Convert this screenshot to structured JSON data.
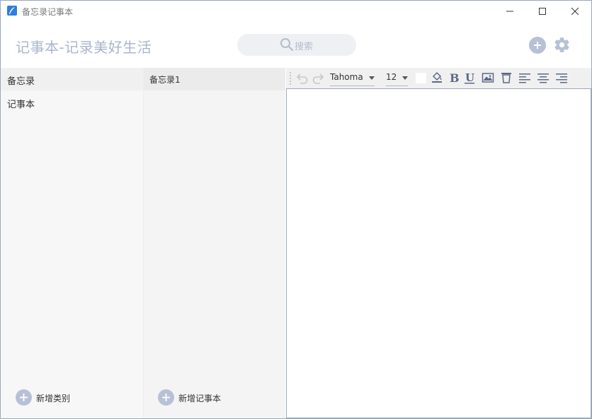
{
  "window": {
    "title": "备忘录记事本",
    "controls": [
      "minimize-icon",
      "maximize-icon",
      "close-icon"
    ]
  },
  "header": {
    "heading": "记事本-记录美好生活",
    "search_placeholder": "搜索",
    "add_icon": "plus-icon",
    "settings_icon": "gear-icon"
  },
  "categories": {
    "header": "备忘录",
    "items": [
      {
        "label": "记事本"
      }
    ],
    "add_label": "新增类别"
  },
  "notes": {
    "header": "备忘录1",
    "add_label": "新增记事本"
  },
  "editor": {
    "toolbar": {
      "font": "Tahoma",
      "size": "12",
      "icons": [
        "undo-icon",
        "redo-icon",
        "fill-color-icon",
        "bold-icon",
        "underline-icon",
        "image-icon",
        "trash-icon",
        "align-left-icon",
        "align-center-icon",
        "align-right-icon"
      ],
      "text_color": "#ffffff"
    },
    "content": ""
  },
  "colors": {
    "accent": "#b7c1d6",
    "heading": "#a9b6cd",
    "border": "#9aa8bb",
    "icon": "#5b6a84"
  }
}
